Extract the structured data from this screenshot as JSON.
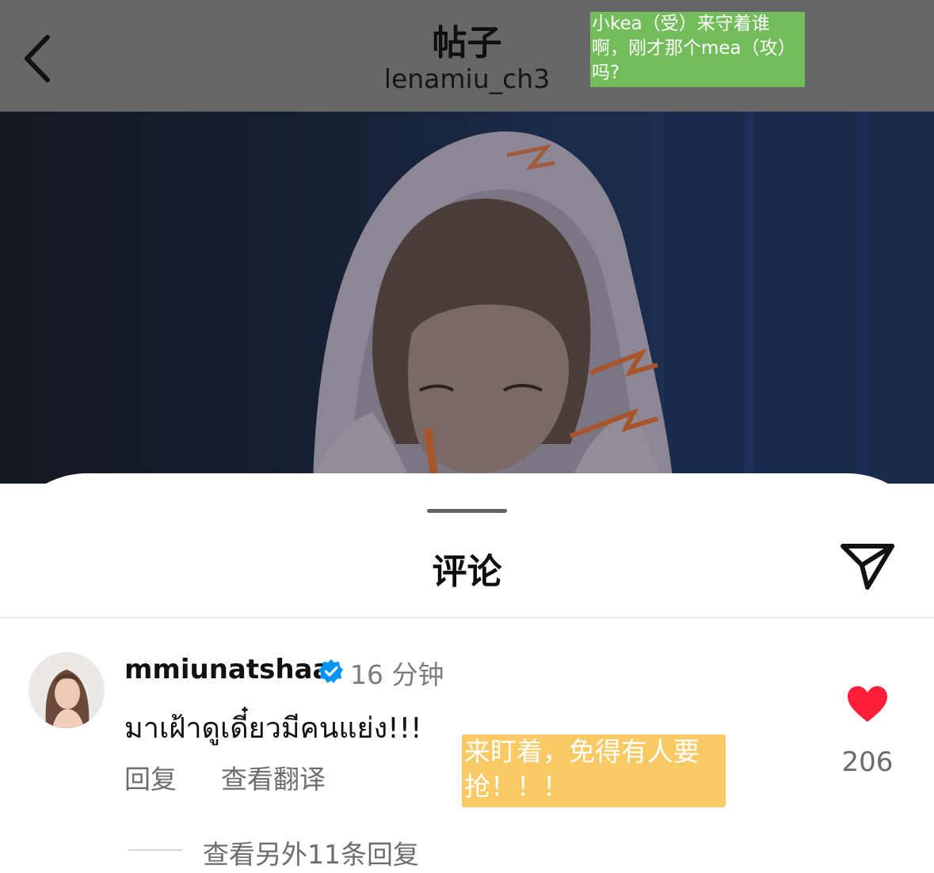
{
  "header": {
    "title": "帖子",
    "subtitle": "lenamiu_ch3"
  },
  "annotations": {
    "green_note": "小kea（受）来守着谁啊，刚才那个mea（攻）吗?",
    "yellow_note": "来盯着，免得有人要抢！！！"
  },
  "sheet": {
    "title": "评论"
  },
  "comment": {
    "username": "mmiunatshaa",
    "time": "16 分钟",
    "text": "มาเฝ้าดูเดี๋ยวมีคนแย่ง!!!",
    "reply_label": "回复",
    "translate_label": "查看翻译",
    "like_count": "206",
    "view_replies_label": "查看另外11条回复"
  },
  "colors": {
    "like_heart": "#ff1e3a",
    "verified_badge": "#0095f6",
    "green_note_bg": "#72bd5a",
    "yellow_note_bg": "#f9c964"
  },
  "icons": {
    "back": "chevron-left-icon",
    "share": "send-icon",
    "verified": "verified-badge-icon",
    "like": "heart-icon"
  }
}
